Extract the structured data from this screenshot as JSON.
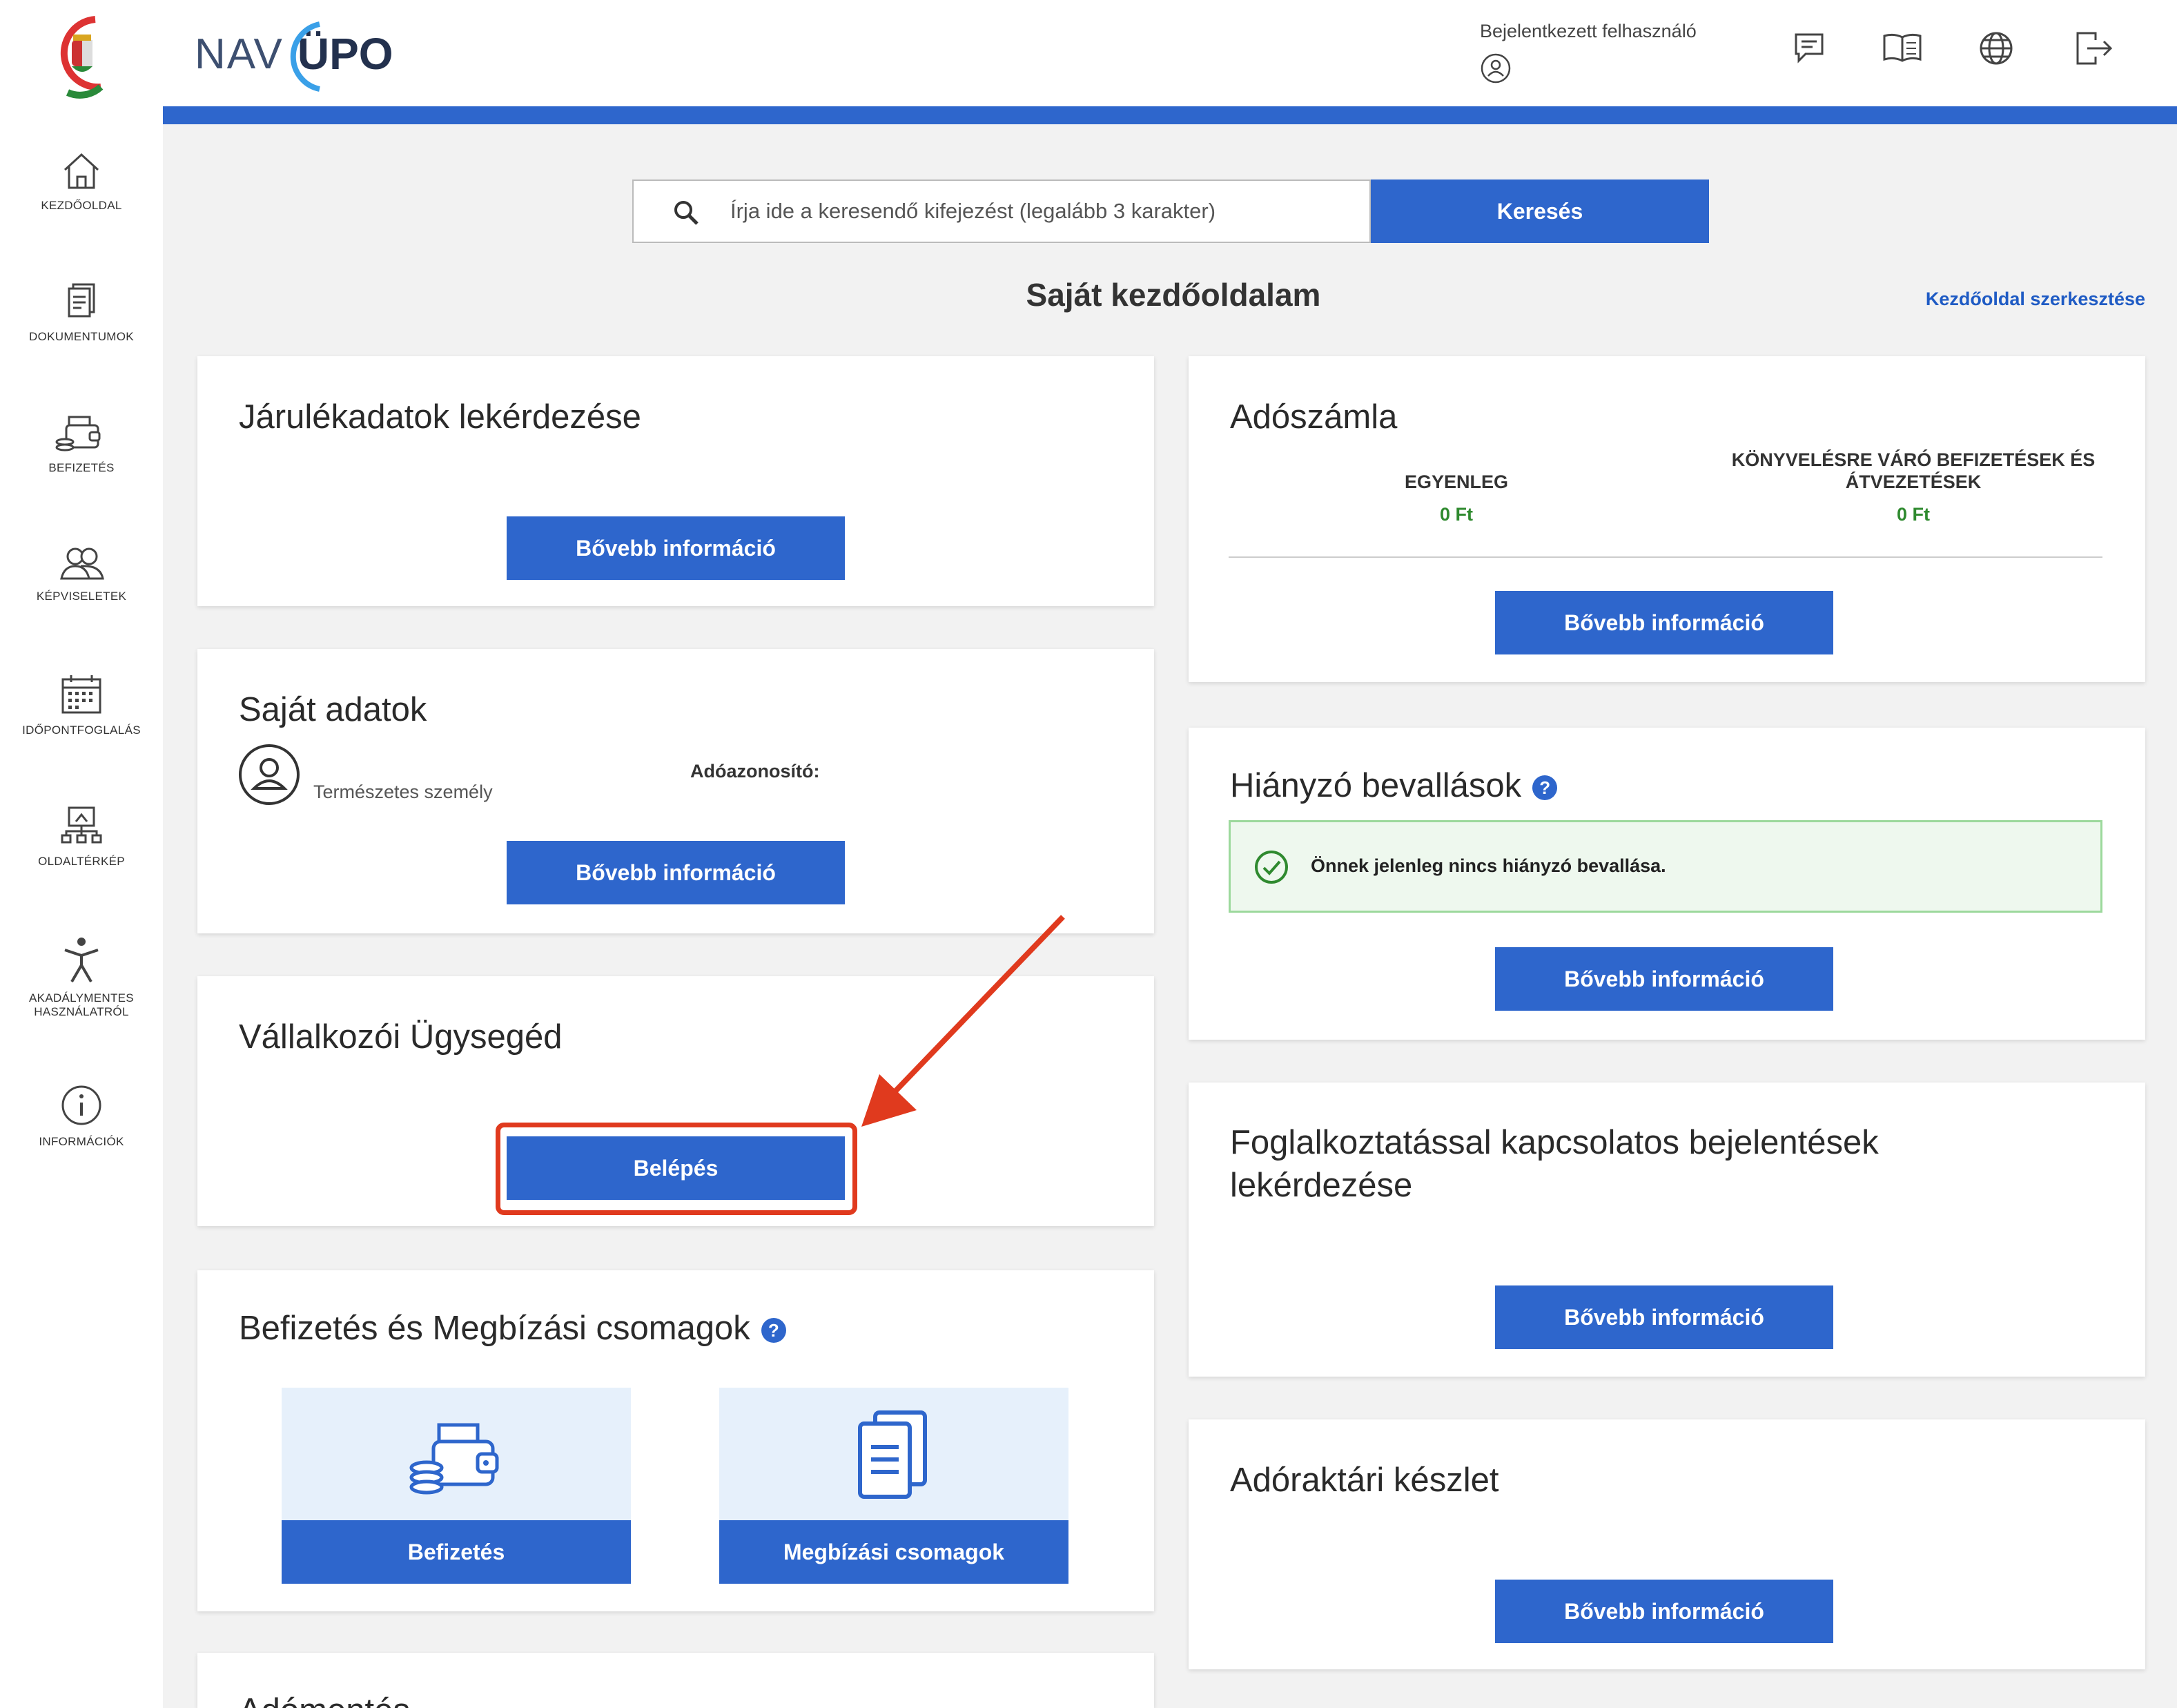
{
  "sidebar": {
    "items": [
      {
        "label": "KEZDŐOLDAL",
        "icon": "home-icon"
      },
      {
        "label": "DOKUMENTUMOK",
        "icon": "documents-icon"
      },
      {
        "label": "BEFIZETÉS",
        "icon": "wallet-icon"
      },
      {
        "label": "KÉPVISELETEK",
        "icon": "people-icon"
      },
      {
        "label": "IDŐPONTFOGLALÁS",
        "icon": "calendar-icon"
      },
      {
        "label": "OLDALTÉRKÉP",
        "icon": "sitemap-icon"
      },
      {
        "label_line1": "AKADÁLYMENTES",
        "label_line2": "HASZNÁLATRÓL",
        "icon": "accessibility-icon"
      },
      {
        "label": "INFORMÁCIÓK",
        "icon": "info-icon"
      }
    ]
  },
  "header": {
    "brand_nav": "NAV",
    "brand_upo": "ÜPO",
    "user_label": "Bejelentkezett felhasználó",
    "icons": [
      "messages-icon",
      "book-icon",
      "globe-icon",
      "logout-icon"
    ]
  },
  "search": {
    "placeholder": "Írja ide a keresendő kifejezést (legalább 3 karakter)",
    "button": "Keresés"
  },
  "page": {
    "title": "Saját kezdőoldalam",
    "edit_link": "Kezdőoldal szerkesztése"
  },
  "cards": {
    "jarulek": {
      "title": "Járulékadatok lekérdezése",
      "button": "Bővebb információ"
    },
    "sajat": {
      "title": "Saját adatok",
      "person_type": "Természetes személy",
      "tax_id_label": "Adóazonosító:",
      "button": "Bővebb információ"
    },
    "vallalkozoi": {
      "title": "Vállalkozói Ügysegéd",
      "button": "Belépés"
    },
    "befizetes": {
      "title": "Befizetés és Megbízási csomagok",
      "tile1": "Befizetés",
      "tile2": "Megbízási csomagok"
    },
    "partial": {
      "title": "Adómentés"
    },
    "adoszamla": {
      "title": "Adószámla",
      "col1_head": "EGYENLEG",
      "col1_value": "0 Ft",
      "col2_head_line1": "KÖNYVELÉSRE VÁRÓ BEFIZETÉSEK ÉS",
      "col2_head_line2": "ÁTVEZETÉSEK",
      "col2_value": "0 Ft",
      "button": "Bővebb információ"
    },
    "hianyzo": {
      "title": "Hiányzó bevallások",
      "notice": "Önnek jelenleg nincs hiányzó bevallása.",
      "button": "Bővebb információ"
    },
    "foglalkoztatas": {
      "title_line1": "Foglalkoztatással kapcsolatos bejelentések",
      "title_line2": "lekérdezése",
      "button": "Bővebb információ"
    },
    "adoraktari": {
      "title": "Adóraktári készlet",
      "button": "Bővebb információ"
    }
  },
  "colors": {
    "primary": "#2e66cc",
    "accent_red": "#e03a1e",
    "success_green": "#2f8a2f"
  }
}
